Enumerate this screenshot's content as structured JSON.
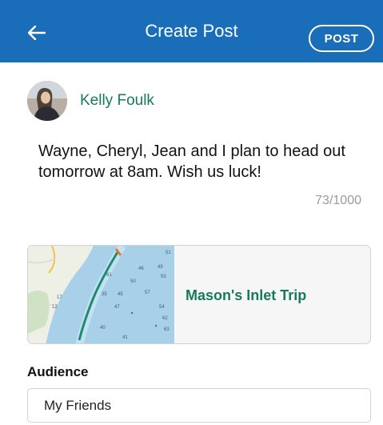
{
  "header": {
    "back_icon": "arrow-left-icon",
    "title": "Create Post",
    "post_label": "POST",
    "background": "#1a6db8"
  },
  "author": {
    "name": "Kelly Foulk"
  },
  "post": {
    "text": "Wayne, Cheryl, Jean and I plan to head out tomorrow at 8am. Wish us luck!",
    "char_count": "73/1000"
  },
  "trip": {
    "title": "Mason's Inlet Trip",
    "map_depths": [
      "51",
      "46",
      "49",
      "53",
      "50",
      "35",
      "45",
      "57",
      "47",
      "54",
      "62",
      "63",
      "41",
      "40",
      "17",
      "12",
      "61"
    ]
  },
  "audience": {
    "label": "Audience",
    "selected": "My Friends"
  },
  "colors": {
    "accent_green": "#17795e",
    "muted_gray": "#9b9b9b"
  }
}
